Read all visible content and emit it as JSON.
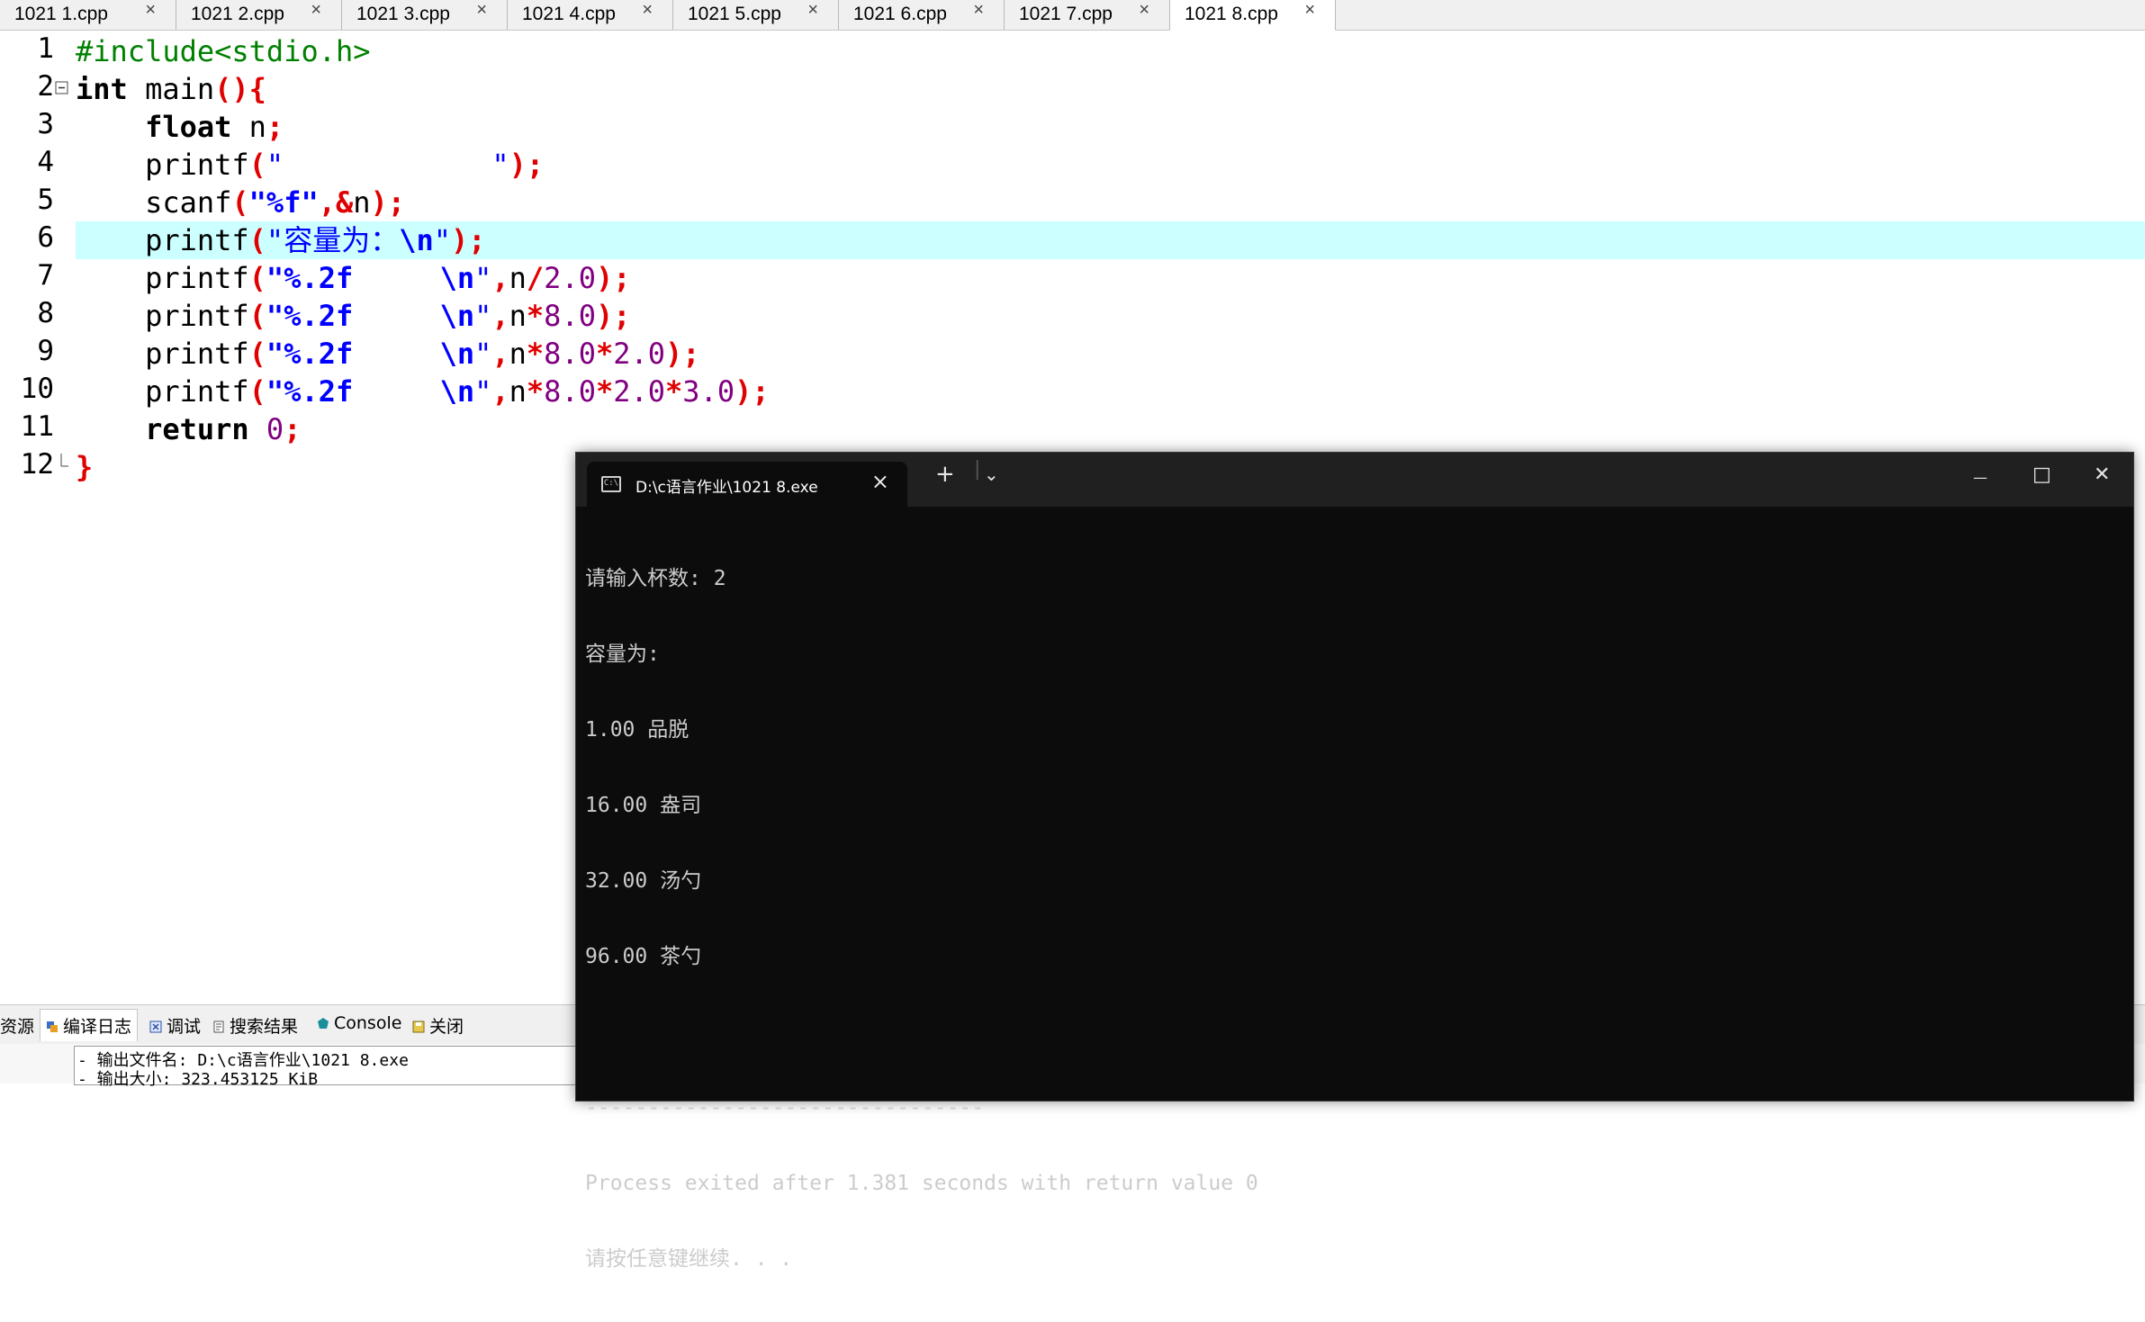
{
  "tabs": [
    {
      "label": "1021 1.cpp",
      "close": "×"
    },
    {
      "label": "1021 2.cpp",
      "close": "×"
    },
    {
      "label": "1021 3.cpp",
      "close": "×"
    },
    {
      "label": "1021 4.cpp",
      "close": "×"
    },
    {
      "label": "1021 5.cpp",
      "close": "×"
    },
    {
      "label": "1021 6.cpp",
      "close": "×"
    },
    {
      "label": "1021 7.cpp",
      "close": "×"
    },
    {
      "label": "1021 8.cpp",
      "close": "×"
    }
  ],
  "active_tab": "1021 8.cpp",
  "editor": {
    "line_numbers": [
      "1",
      "2",
      "3",
      "4",
      "5",
      "6",
      "7",
      "8",
      "9",
      "10",
      "11",
      "12"
    ],
    "current_line": "6",
    "code": [
      [
        "#include<stdio.h>"
      ],
      [
        "int",
        " main",
        "(){"
      ],
      [
        "    ",
        "float",
        " n",
        ";"
      ],
      [
        "    printf",
        "(",
        "\"            \"",
        ");"
      ],
      [
        "    scanf",
        "(",
        "\"%f\"",
        ",&",
        "n",
        ");"
      ],
      [
        "    printf",
        "(",
        "\"容量为：",
        "\\n",
        "\"",
        ");"
      ],
      [
        "    printf",
        "(",
        "\"%.2f     ",
        "\\n",
        "\"",
        ",",
        "n",
        "/",
        "2.0",
        ");"
      ],
      [
        "    printf",
        "(",
        "\"%.2f     ",
        "\\n",
        "\"",
        ",",
        "n",
        "*",
        "8.0",
        ");"
      ],
      [
        "    printf",
        "(",
        "\"%.2f     ",
        "\\n",
        "\"",
        ",",
        "n",
        "*",
        "8.0",
        "*",
        "2.0",
        ");"
      ],
      [
        "    printf",
        "(",
        "\"%.2f     ",
        "\\n",
        "\"",
        ",",
        "n",
        "*",
        "8.0",
        "*",
        "2.0",
        "*",
        "3.0",
        ");"
      ],
      [
        "    ",
        "return",
        " ",
        "0",
        ";"
      ],
      [
        "}"
      ]
    ]
  },
  "bottom_tabs": [
    {
      "label": "资源",
      "icon": "resources-icon"
    },
    {
      "label": "编译日志",
      "icon": "compile-log-icon"
    },
    {
      "label": "调试",
      "icon": "debug-icon"
    },
    {
      "label": "搜索结果",
      "icon": "search-results-icon"
    },
    {
      "label": "Console",
      "icon": "console-icon"
    },
    {
      "label": "关闭",
      "icon": "close-panel-icon"
    }
  ],
  "log_lines": [
    "- 输出文件名: D:\\c语言作业\\1021 8.exe",
    "- 输出大小: 323.453125 KiB"
  ],
  "console": {
    "tab_title": "D:\\c语言作业\\1021 8.exe",
    "tab_close": "×",
    "new_tab": "+",
    "dropdown": "⌄",
    "minimize": "—",
    "maximize": "□",
    "close": "✕",
    "lines": [
      "请输入杯数: 2",
      "容量为:",
      "1.00 品脱",
      "16.00 盎司",
      "32.00 汤勺",
      "96.00 茶勺",
      "",
      "--------------------------------",
      "Process exited after 1.381 seconds with return value 0",
      "请按任意键继续. . ."
    ]
  },
  "colors": {
    "keyword": "#000000",
    "preprocessor": "#008000",
    "symbol": "#e00000",
    "string": "#0000ff",
    "number": "#800080",
    "current_line": "#ccffff",
    "console_bg": "#0c0c0c",
    "console_text": "#cccccc"
  }
}
